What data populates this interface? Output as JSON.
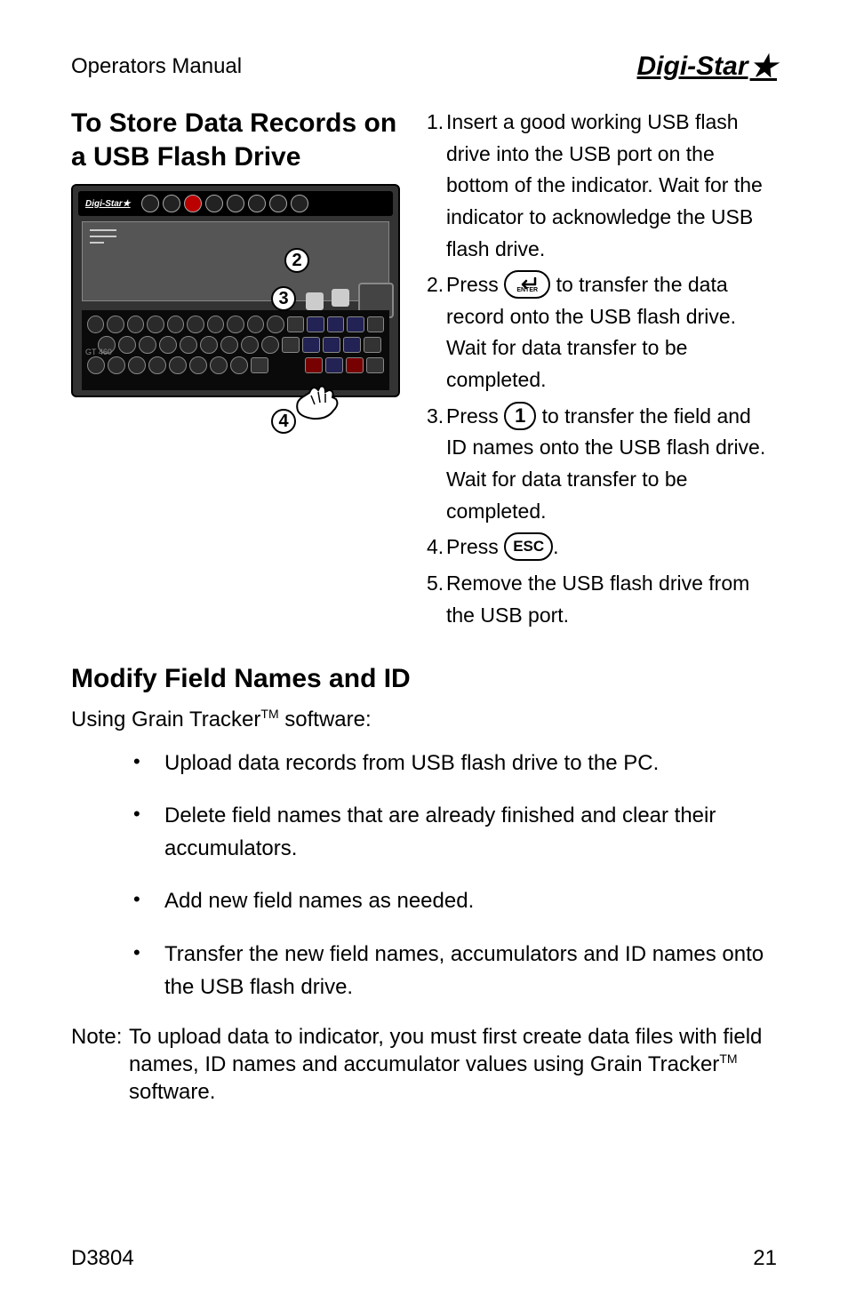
{
  "header": {
    "label": "Operators Manual",
    "brand": "Digi-Star"
  },
  "section1": {
    "title": "To Store Data Records on a USB Flash Drive",
    "device_model": "GT 460",
    "callouts": {
      "c2": "2",
      "c3": "3",
      "c4": "4"
    },
    "steps": {
      "s1_num": "1.",
      "s1_text": "Insert a good working USB flash drive into the USB port on the bottom of the indicator. Wait for the indicator to acknowledge the USB flash drive.",
      "s2_num": "2.",
      "s2_a": "Press ",
      "s2_enter_label": "ENTER",
      "s2_b": " to transfer the data record onto the USB flash drive. Wait for data transfer to be completed.",
      "s3_num": "3.",
      "s3_a": "Press ",
      "s3_key": "1",
      "s3_b": " to transfer the field and ID names onto the USB flash drive. Wait for data transfer to be completed.",
      "s4_num": "4.",
      "s4_a": "Press ",
      "s4_key": "ESC",
      "s4_b": ".",
      "s5_num": "5.",
      "s5_text": "Remove the USB flash drive from the USB port."
    }
  },
  "section2": {
    "title": "Modify Field Names and ID",
    "subtitle_a": "Using Grain Tracker",
    "subtitle_tm": "TM",
    "subtitle_b": " software:",
    "bullets": {
      "b1": "Upload data records from USB flash drive to the PC.",
      "b2": "Delete field names that are already finished and clear their accumulators.",
      "b3": "Add new field names as needed.",
      "b4": "Transfer the new field names, accumulators and ID names onto the USB flash drive."
    },
    "note_label": "Note:",
    "note_a": "To upload data to indicator, you must first create data files with field names, ID names and accumulator values using Grain Tracker",
    "note_tm": "TM",
    "note_b": " software."
  },
  "footer": {
    "left": "D3804",
    "right": "21"
  }
}
